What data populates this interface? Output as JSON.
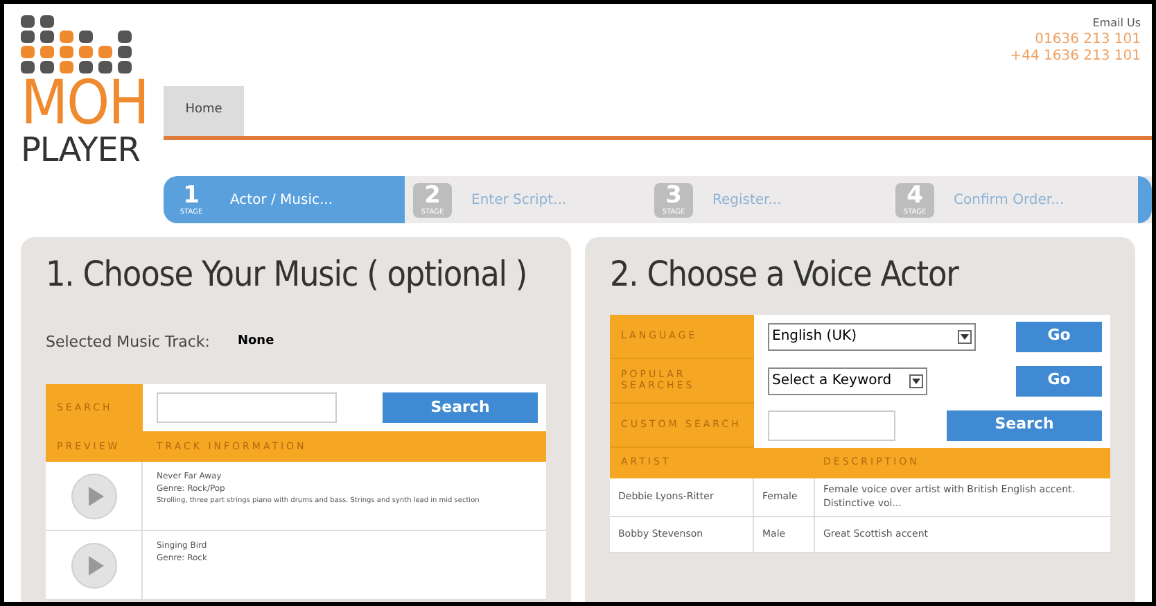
{
  "logo": {
    "top": "MOH",
    "bottom": "PLAYER"
  },
  "contact": {
    "email": "Email Us",
    "phone": "01636 213 101",
    "intl": "+44 1636 213 101"
  },
  "nav": [
    {
      "label": "Home",
      "selected": true
    }
  ],
  "stages": [
    {
      "number": "1",
      "tag": "STAGE",
      "label": "Actor / Music...",
      "selected": true
    },
    {
      "number": "2",
      "tag": "STAGE",
      "label": "Enter Script...",
      "selected": false
    },
    {
      "number": "3",
      "tag": "STAGE",
      "label": "Register...",
      "selected": false
    },
    {
      "number": "4",
      "tag": "STAGE",
      "label": "Confirm Order...",
      "selected": false
    }
  ],
  "music": {
    "title": "1. Choose Your Music ( optional )",
    "selected_label": "Selected Music Track:",
    "selected_value": "None",
    "search_label": "SEARCH",
    "search_button": "Search",
    "columns": [
      "PREVIEW",
      "TRACK INFORMATION"
    ],
    "tracks": [
      {
        "title": "Never Far Away",
        "genre": "Genre: Rock/Pop",
        "description": "Strolling, three part strings piano with drums and bass. Strings and synth lead in mid section"
      },
      {
        "title": "Singing Bird",
        "genre": "Genre: Rock"
      }
    ]
  },
  "voice": {
    "title": "2. Choose a Voice Actor",
    "filters": [
      {
        "kind": "select",
        "label": "LANGUAGE",
        "value": "English (UK)",
        "button": "Go"
      },
      {
        "kind": "select",
        "label": "POPULAR SEARCHES",
        "value": "Select a Keyword",
        "button": "Go"
      },
      {
        "kind": "text",
        "label": "CUSTOM SEARCH",
        "button": "Search"
      }
    ],
    "columns": [
      "ARTIST",
      "DESCRIPTION"
    ],
    "rows": [
      {
        "artist": "Debbie Lyons-Ritter",
        "gender": "Female",
        "description": "Female voice over artist with British English accent. Distinctive voi..."
      },
      {
        "artist": "Bobby Stevenson",
        "gender": "Male",
        "description": "Great Scottish accent"
      }
    ]
  }
}
